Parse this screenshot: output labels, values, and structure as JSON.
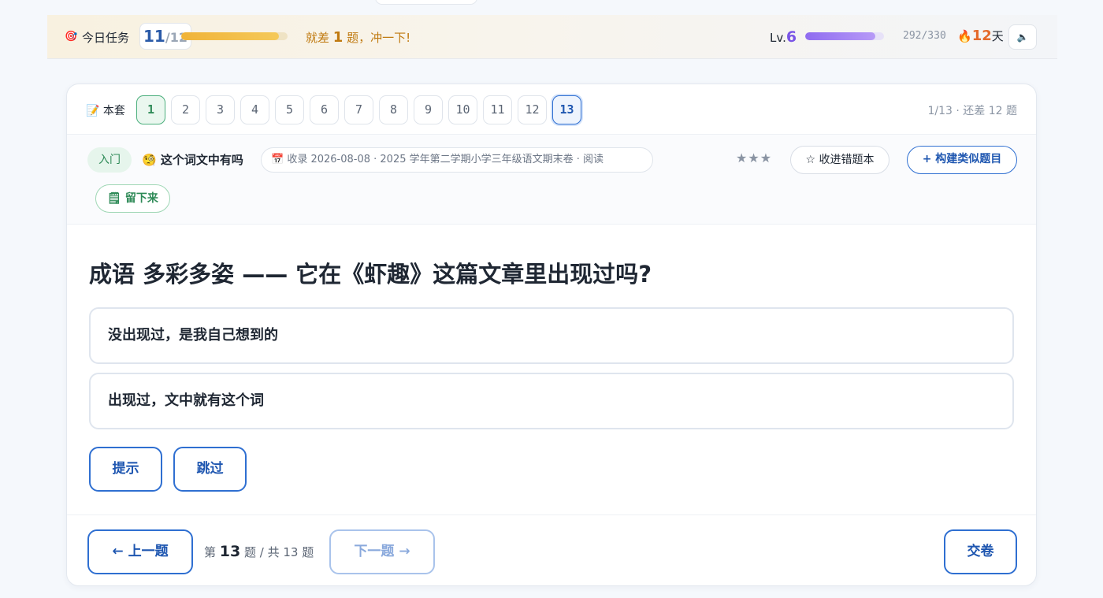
{
  "taskbar": {
    "icon": "target-icon",
    "label": "今日任务",
    "done": "11",
    "total": "12",
    "progress": 0.917,
    "hint_prefix": "就差 ",
    "hint_num": "1",
    "hint_suffix": " 题，冲一下!",
    "level_prefix": "Lv.",
    "level": "6",
    "xp_progress": 0.885,
    "xp": "292/330",
    "streak_icon": "🔥",
    "streak": "12",
    "streak_unit": "天",
    "sound_icon": "🔈"
  },
  "set": {
    "icon": "📝",
    "label": "本套",
    "questions": [
      "1",
      "2",
      "3",
      "4",
      "5",
      "6",
      "7",
      "8",
      "9",
      "10",
      "11",
      "12",
      "13"
    ],
    "progress_text": "1/13 · 还差 12 题"
  },
  "meta": {
    "level": "入门",
    "type_icon": "🧐",
    "type": "这个词文中有吗",
    "source_icon": "📅",
    "source": "收录 2026-08-08 · 2025 学年第二学期小学三年级语文期末卷 · 阅读",
    "stars": "★★★",
    "wrongbook_label": "☆ 收进错题本",
    "similar_label": "+ 构建类似题目",
    "keep_icon": "🗒",
    "keep_label": "留下来"
  },
  "question": {
    "text": "成语 多彩多姿 —— 它在《虾趣》这篇文章里出现过吗?",
    "options": [
      "没出现过，是我自己想到的",
      "出现过，文中就有这个词"
    ],
    "hint_label": "提示",
    "skip_label": "跳过"
  },
  "nav": {
    "prev_label": "← 上一题",
    "pager_prefix": "第 ",
    "current": "13",
    "pager_suffix": " 题 / 共 13 题",
    "next_label": "下一题 →",
    "submit_label": "交卷"
  },
  "colors": {
    "accent": "#2f6fd1",
    "done": "#4caf7d",
    "xp": "#8f6cf0",
    "task": "#f0b338"
  }
}
